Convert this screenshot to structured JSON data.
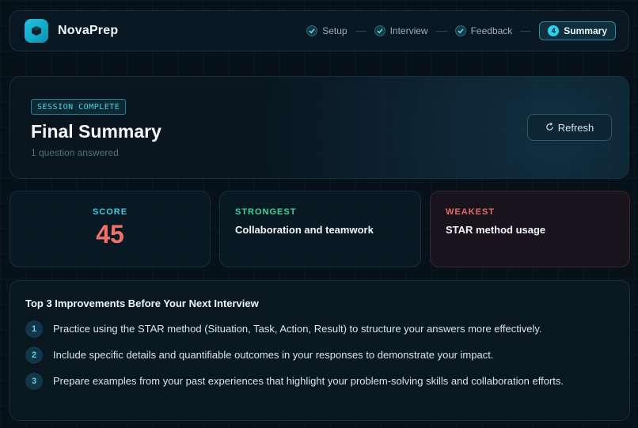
{
  "app": {
    "name": "NovaPrep"
  },
  "steps": [
    {
      "label": "Setup",
      "state": "done"
    },
    {
      "label": "Interview",
      "state": "done"
    },
    {
      "label": "Feedback",
      "state": "done"
    },
    {
      "label": "Summary",
      "state": "active",
      "number": "4"
    }
  ],
  "summary": {
    "badge": "SESSION COMPLETE",
    "title": "Final Summary",
    "subtitle": "1 question answered",
    "refresh_label": "Refresh"
  },
  "stats": {
    "score": {
      "label": "SCORE",
      "value": "45"
    },
    "strongest": {
      "label": "STRONGEST",
      "value": "Collaboration and teamwork"
    },
    "weakest": {
      "label": "WEAKEST",
      "value": "STAR method usage"
    }
  },
  "improvements": {
    "title": "Top 3 Improvements Before Your Next Interview",
    "items": [
      {
        "number": "1",
        "text": "Practice using the STAR method (Situation, Task, Action, Result) to structure your answers more effectively."
      },
      {
        "number": "2",
        "text": "Include specific details and quantifiable outcomes in your responses to demonstrate your impact."
      },
      {
        "number": "3",
        "text": "Prepare examples from your past experiences that highlight your problem-solving skills and collaboration efforts."
      }
    ]
  },
  "colors": {
    "accent": "#2fd0ea",
    "score": "#f2706b",
    "strong": "#3ed39c",
    "weak": "#e86a6a"
  }
}
